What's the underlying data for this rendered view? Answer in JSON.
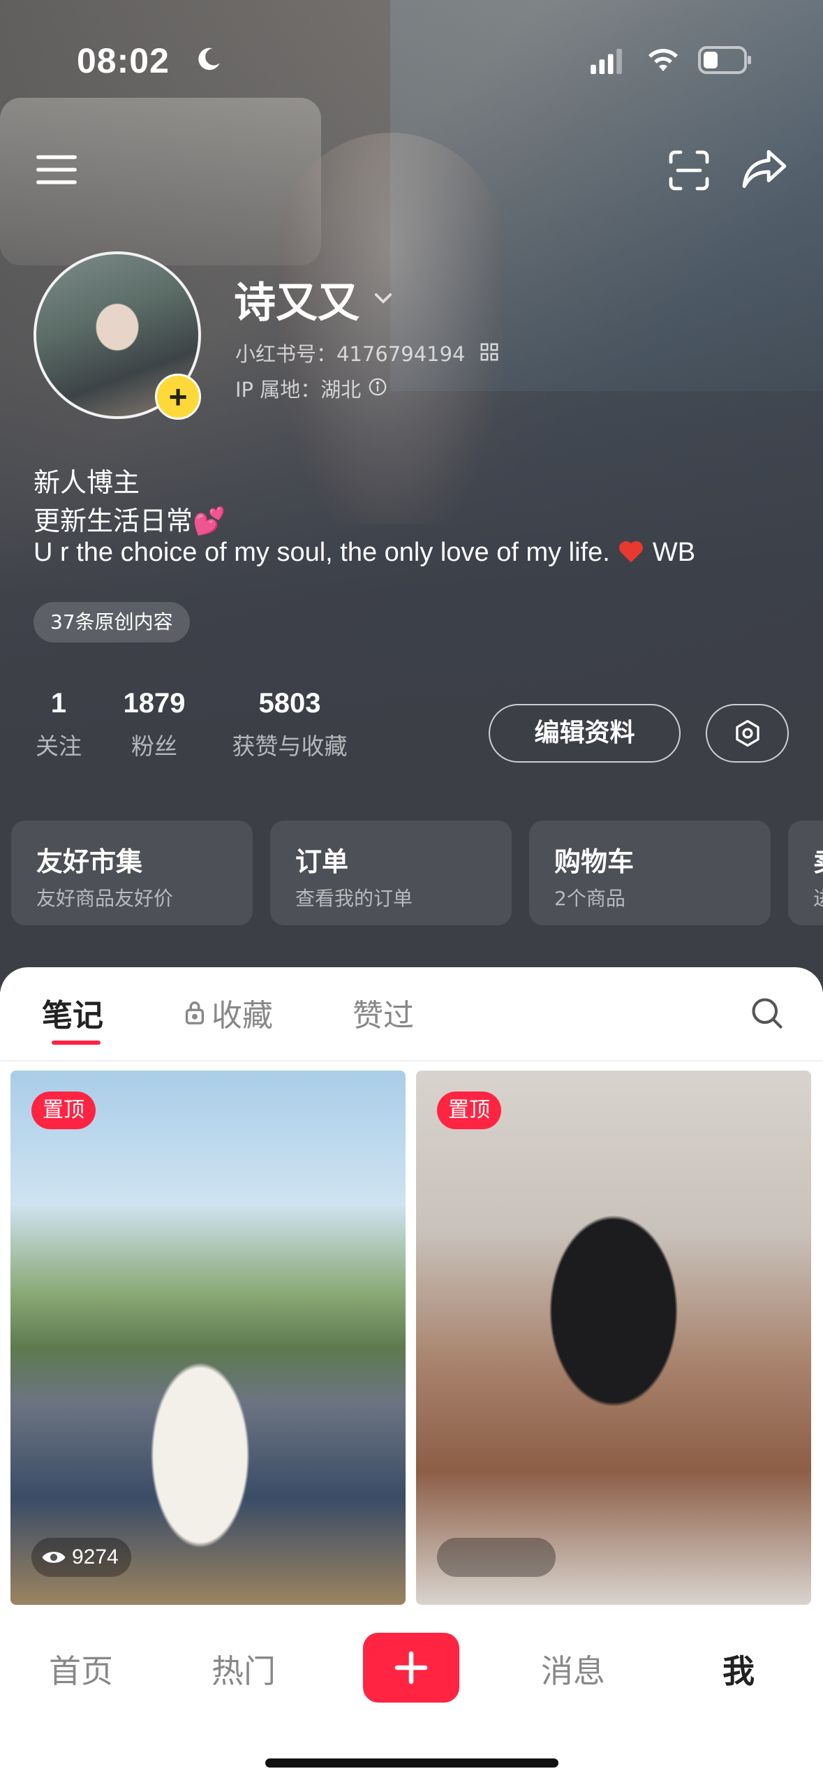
{
  "status_bar": {
    "time": "08:02"
  },
  "profile": {
    "name": "诗又又",
    "red_id": "小红书号：4176794194",
    "ip_location": "IP 属地：湖北",
    "bio_line1": "新人博主",
    "bio_line2": "更新生活日常💕",
    "bio_line3": "U r the choice of my soul, the only love of my life.",
    "bio_line3_suffix": "WB",
    "original_badge": "37条原创内容"
  },
  "stats": {
    "following": {
      "value": "1",
      "label": "关注"
    },
    "fans": {
      "value": "1879",
      "label": "粉丝"
    },
    "likes": {
      "value": "5803",
      "label": "获赞与收藏"
    }
  },
  "buttons": {
    "edit_profile": "编辑资料"
  },
  "cards": [
    {
      "title": "友好市集",
      "subtitle": "友好商品友好价"
    },
    {
      "title": "订单",
      "subtitle": "查看我的订单"
    },
    {
      "title": "购物车",
      "subtitle": "2个商品"
    },
    {
      "title": "卖",
      "subtitle": "进"
    }
  ],
  "tabs": {
    "notes": "笔记",
    "favorites": "收藏",
    "liked": "赞过"
  },
  "notes": [
    {
      "pin": "置顶",
      "views": "9274"
    },
    {
      "pin": "置顶",
      "views": ""
    }
  ],
  "bottom_nav": {
    "home": "首页",
    "hot": "热门",
    "messages": "消息",
    "me": "我"
  },
  "colors": {
    "brand_red": "#ff2442",
    "avatar_plus": "#ffd93a",
    "header_dark": "#3d3f47"
  }
}
